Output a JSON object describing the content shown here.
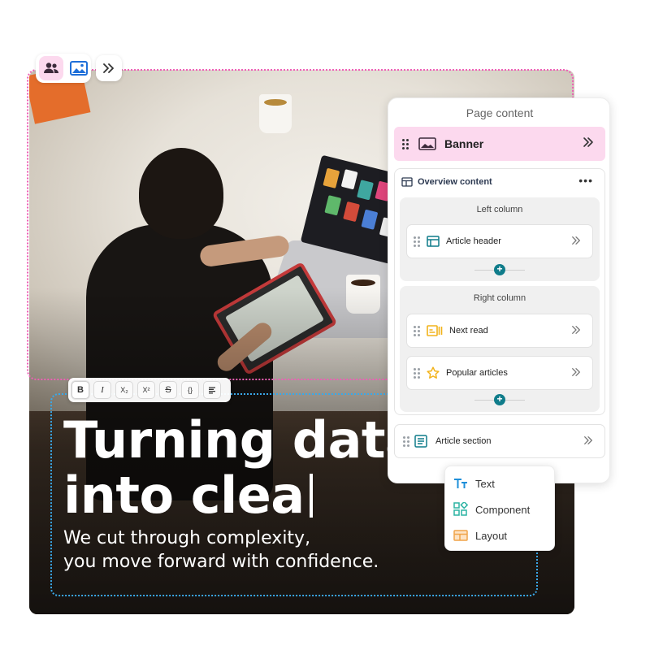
{
  "toolbar_top": {
    "users_icon": "users-icon",
    "image_icon": "image-icon",
    "expand_icon": "double-chevron-right-icon"
  },
  "format_toolbar": {
    "bold": "B",
    "italic": "I",
    "subscript": "X₂",
    "superscript": "X²",
    "strikethrough": "S",
    "code": "{}",
    "align": "align-icon"
  },
  "hero": {
    "headline_line1": "Turning data",
    "headline_line2": "into clea",
    "subline_line1": "We cut through complexity,",
    "subline_line2": "you move forward with confidence."
  },
  "panel": {
    "title": "Page content",
    "banner_label": "Banner",
    "overview_label": "Overview content",
    "more": "•••",
    "left_column": {
      "title": "Left column",
      "items": [
        {
          "label": "Article header",
          "icon": "article-header-icon"
        }
      ]
    },
    "right_column": {
      "title": "Right column",
      "items": [
        {
          "label": "Next read",
          "icon": "next-read-icon"
        },
        {
          "label": "Popular articles",
          "icon": "star-icon"
        }
      ]
    },
    "article_section_label": "Article section"
  },
  "insert_menu": {
    "items": [
      {
        "label": "Text",
        "icon": "text-icon"
      },
      {
        "label": "Component",
        "icon": "component-icon"
      },
      {
        "label": "Layout",
        "icon": "layout-icon"
      }
    ]
  },
  "colors": {
    "accent_teal": "#0f7c8a",
    "banner_pink": "#fcd9ee",
    "outline_pink": "#ef5fb6",
    "outline_blue": "#3aa8e8",
    "star_gold": "#f2b31b"
  }
}
